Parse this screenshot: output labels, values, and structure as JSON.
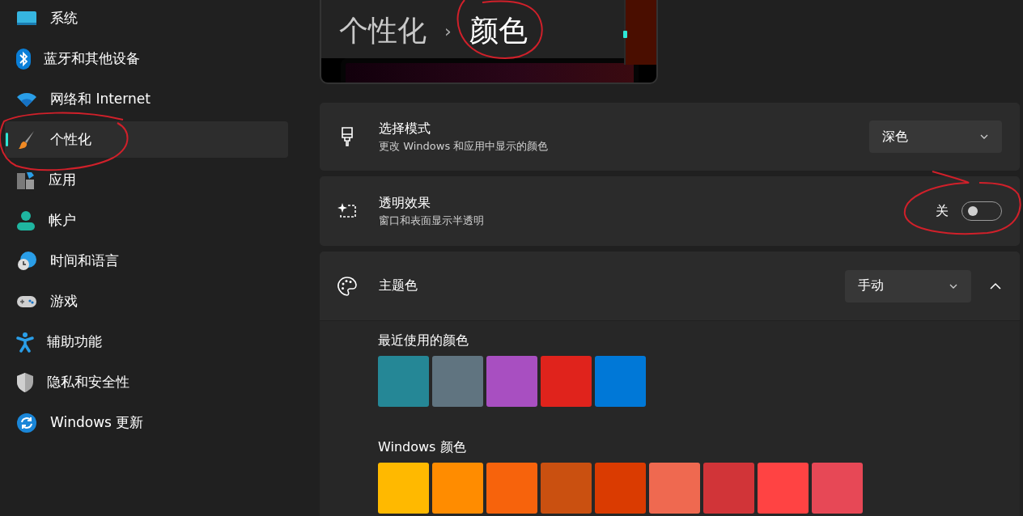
{
  "sidebar": {
    "items": [
      {
        "label": "系统",
        "selected": false
      },
      {
        "label": "蓝牙和其他设备",
        "selected": false
      },
      {
        "label": "网络和 Internet",
        "selected": false
      },
      {
        "label": "个性化",
        "selected": true
      },
      {
        "label": "应用",
        "selected": false
      },
      {
        "label": "帐户",
        "selected": false
      },
      {
        "label": "时间和语言",
        "selected": false
      },
      {
        "label": "游戏",
        "selected": false
      },
      {
        "label": "辅助功能",
        "selected": false
      },
      {
        "label": "隐私和安全性",
        "selected": false
      },
      {
        "label": "Windows 更新",
        "selected": false
      }
    ]
  },
  "breadcrumb": {
    "parent": "个性化",
    "separator": "›",
    "current": "颜色"
  },
  "settings": [
    {
      "kind": "dropdown",
      "title": "选择模式",
      "description": "更改 Windows 和应用中显示的颜色",
      "value": "深色"
    },
    {
      "kind": "toggle",
      "title": "透明效果",
      "description": "窗口和表面显示半透明",
      "state_label": "关",
      "on": false
    },
    {
      "kind": "expander",
      "title": "主题色",
      "value": "手动",
      "expanded": true
    }
  ],
  "recent_colors": {
    "title": "最近使用的颜色",
    "swatches": [
      {
        "color": "#258796"
      },
      {
        "color": "#607480"
      },
      {
        "color": "#a84fc1"
      },
      {
        "color": "#e0231c"
      },
      {
        "color": "#0078d7"
      }
    ]
  },
  "windows_colors": {
    "title": "Windows 颜色",
    "swatches": [
      {
        "color": "#ffb900"
      },
      {
        "color": "#ff8c00"
      },
      {
        "color": "#f7630c"
      },
      {
        "color": "#ca5010"
      },
      {
        "color": "#da3b01"
      },
      {
        "color": "#ef6950"
      },
      {
        "color": "#d13438"
      },
      {
        "color": "#ff4343"
      },
      {
        "color": "#e74856"
      }
    ]
  }
}
